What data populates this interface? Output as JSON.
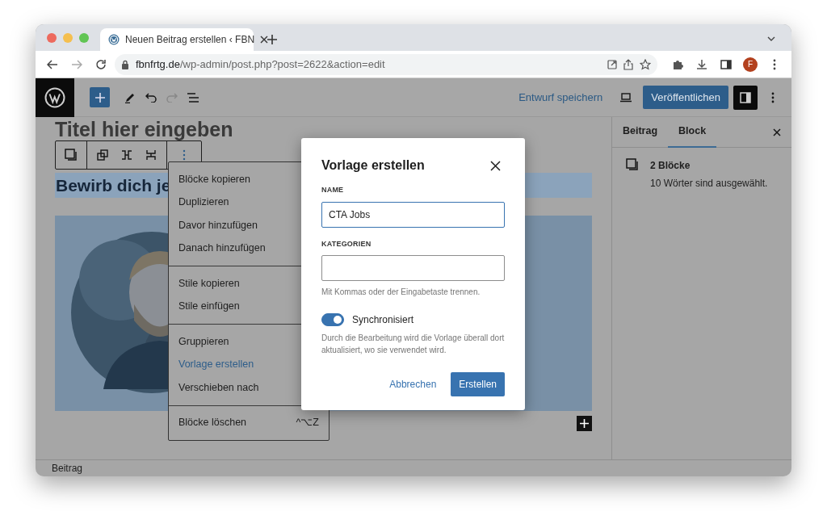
{
  "browser": {
    "tab_title": "Neuen Beitrag erstellen ‹ FBN",
    "address_domain": "fbnfrtg.de",
    "address_path": "/wp-admin/post.php?post=2622&action=edit",
    "profile_initial": "F"
  },
  "toolbar": {
    "save_draft": "Entwurf speichern",
    "publish": "Veröffentlichen",
    "settings_open": true
  },
  "canvas": {
    "title_placeholder": "Titel hier eingeben",
    "heading": "Bewirb dich je"
  },
  "block_menu": [
    [
      {
        "label": "Blöcke kopieren",
        "selected": false
      },
      {
        "label": "Duplizieren",
        "selected": false
      },
      {
        "label": "Davor hinzufügen",
        "selected": false
      },
      {
        "label": "Danach hinzufügen",
        "selected": false
      }
    ],
    [
      {
        "label": "Stile kopieren",
        "selected": false
      },
      {
        "label": "Stile einfügen",
        "selected": false
      }
    ],
    [
      {
        "label": "Gruppieren",
        "selected": false
      },
      {
        "label": "Vorlage erstellen",
        "selected": true
      },
      {
        "label": "Verschieben nach",
        "selected": false
      }
    ],
    [
      {
        "label": "Blöcke löschen",
        "selected": false,
        "shortcut": "^⌥Z"
      }
    ]
  ],
  "sidebar": {
    "tabs": [
      {
        "label": "Beitrag",
        "selected": false
      },
      {
        "label": "Block",
        "selected": true
      }
    ],
    "block_title": "2 Blöcke",
    "block_description": "10 Wörter sind ausgewählt."
  },
  "modal": {
    "title": "Vorlage erstellen",
    "fields": [
      {
        "label": "NAME",
        "value": "CTA Jobs",
        "focused": true
      },
      {
        "label": "KATEGORIEN",
        "focused": false,
        "help": "Mit Kommas oder der Eingabetaste trennen."
      }
    ],
    "toggle": {
      "label": "Synchronisiert",
      "on": true,
      "description": "Durch die Bearbeitung wird die Vorlage überall dort aktualisiert, wo sie verwendet wird."
    },
    "cancel": "Abbrechen",
    "create": "Erstellen"
  },
  "footer": {
    "breadcrumb": "Beitrag"
  }
}
